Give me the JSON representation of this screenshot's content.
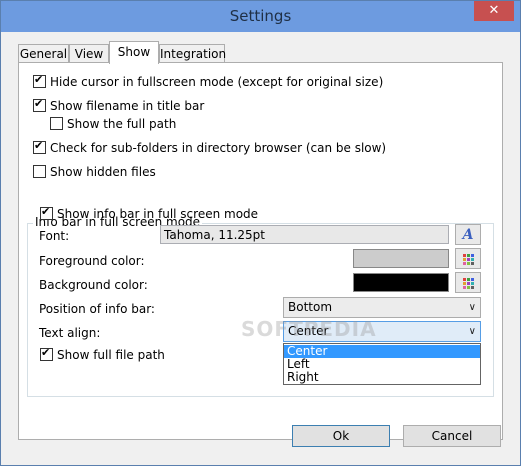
{
  "window": {
    "title": "Settings",
    "close_glyph": "✕"
  },
  "tabs": [
    {
      "label": "General"
    },
    {
      "label": "View"
    },
    {
      "label": "Show"
    },
    {
      "label": "Integration"
    }
  ],
  "options": {
    "hide_cursor": {
      "label": "Hide cursor in fullscreen mode (except for original size)",
      "checked": true
    },
    "show_filename": {
      "label": "Show filename in title bar",
      "checked": true
    },
    "show_full_path": {
      "label": "Show the full path",
      "checked": false
    },
    "check_subfolders": {
      "label": "Check for sub-folders in directory browser (can be slow)",
      "checked": true
    },
    "show_hidden": {
      "label": "Show hidden files",
      "checked": false
    }
  },
  "infobar": {
    "group_title": "Info bar in full screen mode",
    "show_infobar": {
      "label": "Show info bar in full screen mode",
      "checked": true
    },
    "font_label": "Font:",
    "font_value": "Tahoma, 11.25pt",
    "font_button_glyph": "A",
    "foreground_label": "Foreground color:",
    "foreground_color": "#cccccc",
    "background_label": "Background color:",
    "background_color": "#000000",
    "position_label": "Position of info bar:",
    "position_value": "Bottom",
    "align_label": "Text align:",
    "align_value": "Center",
    "align_options": [
      "Center",
      "Left",
      "Right"
    ],
    "show_full_file_path": {
      "label": "Show full file path",
      "checked": true
    }
  },
  "watermark": "SOFTPEDIA",
  "buttons": {
    "ok": "Ok",
    "cancel": "Cancel"
  },
  "colors": {
    "titlebar": "#6d9be0",
    "selection": "#3399ff",
    "close": "#c75050"
  },
  "icons": {
    "palette": "palette-icon",
    "font": "font-icon",
    "chevron": "chevron-down-icon"
  }
}
